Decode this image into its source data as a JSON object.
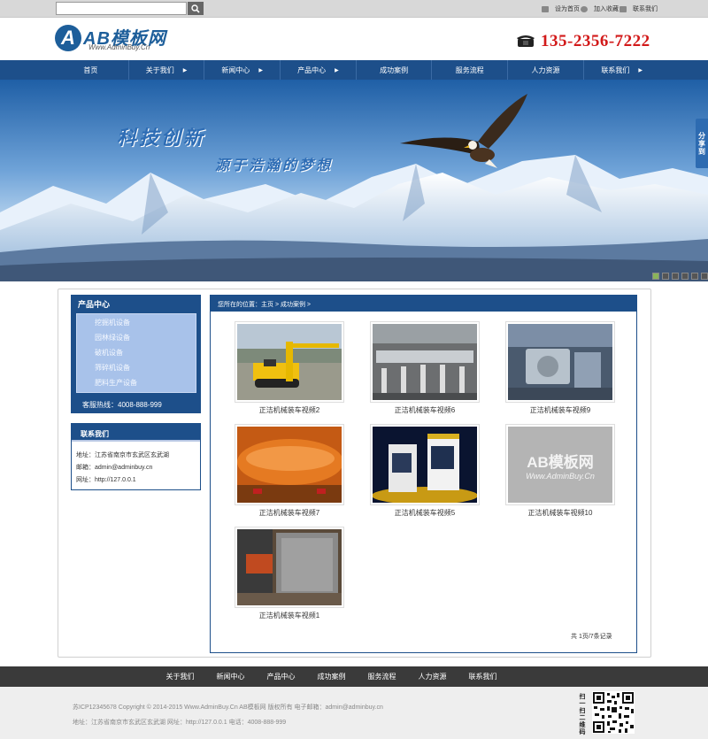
{
  "topbar": {
    "search_placeholder": "",
    "links": [
      "设为首页",
      "加入收藏",
      "联系我们"
    ]
  },
  "header": {
    "logo_letter": "A",
    "logo_text": "AB模板网",
    "logo_sub": "Www.AdminBuy.Cn",
    "phone": "135-2356-7222"
  },
  "nav": {
    "items": [
      "首页",
      "关于我们",
      "新闻中心",
      "产品中心",
      "成功案例",
      "服务流程",
      "人力资源",
      "联系我们"
    ],
    "arrow": "▶"
  },
  "banner": {
    "title1": "科技创新",
    "title2": "源于浩瀚的梦想",
    "share": [
      "分",
      "享",
      "到"
    ]
  },
  "sidebar": {
    "product_title": "产品中心",
    "product_items": [
      "挖掘机设备",
      "园林绿设备",
      "破机设备",
      "筛碎机设备",
      "肥料生产设备"
    ],
    "hotline": "客服热线：4008-888-999",
    "contact_title": "联系我们",
    "contact_lines": [
      "地址：江苏省南京市玄武区玄武湖",
      "邮箱：admin@adminbuy.cn",
      "网址：http://127.0.0.1"
    ]
  },
  "content": {
    "breadcrumb": "您所在的位置：主页 > 成功案例 >",
    "items": [
      {
        "caption": "正洁机械装车视频2",
        "image": "yellow-drill-rig"
      },
      {
        "caption": "正洁机械装车视频6",
        "image": "factory-line"
      },
      {
        "caption": "正洁机械装车视频9",
        "image": "workshop-machinery"
      },
      {
        "caption": "正洁机械装车视频7",
        "image": "orange-tank"
      },
      {
        "caption": "正洁机械装车视频5",
        "image": "cnc-machines"
      },
      {
        "caption": "正洁机械装车视频10",
        "image": "placeholder-logo"
      },
      {
        "caption": "正洁机械装车视频1",
        "image": "container-loading"
      }
    ],
    "placeholder_logo": "AB模板网",
    "placeholder_sub": "Www.AdminBuy.Cn",
    "pager": "共 1页/7条记录"
  },
  "footer": {
    "nav": [
      "关于我们",
      "新闻中心",
      "产品中心",
      "成功案例",
      "服务流程",
      "人力资源",
      "联系我们"
    ],
    "line1": "苏ICP12345678   Copyright © 2014-2015 Www.AdminBuy.Cn AB模板网 版权所有   电子邮箱：admin@adminbuy.cn",
    "line2": "地址：江苏省南京市玄武区玄武湖   网址：http://127.0.0.1   电话：4008-888-999",
    "qr_label": "扫一扫二维码"
  },
  "colors": {
    "brand": "#1d4f8a",
    "phone": "#d21a1a",
    "footer_nav": "#3a3a3a"
  }
}
